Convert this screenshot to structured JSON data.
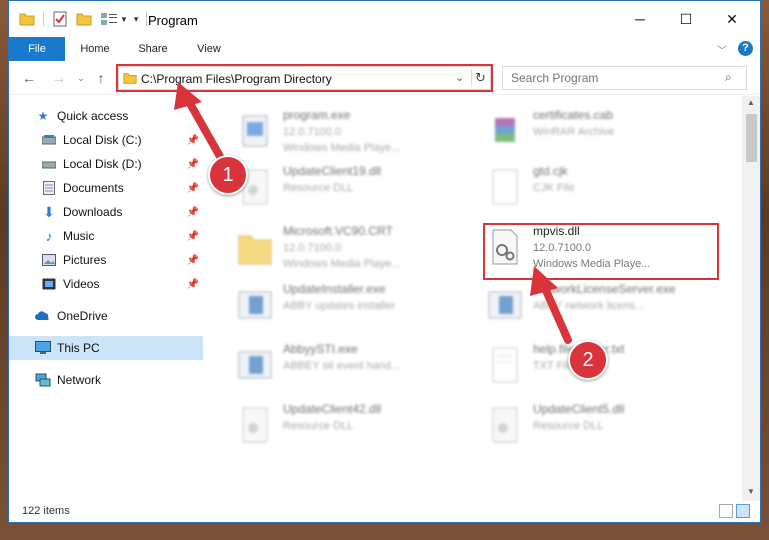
{
  "window": {
    "title": "Program",
    "minimize": "─",
    "maximize": "☐",
    "close": "✕"
  },
  "ribbon": {
    "tabs": [
      "File",
      "Home",
      "Share",
      "View"
    ]
  },
  "address": {
    "path": "C:\\Program Files\\Program Directory"
  },
  "search": {
    "placeholder": "Search Program"
  },
  "sidebar": {
    "items": [
      {
        "label": "Quick access",
        "icon": "star-icon"
      },
      {
        "label": "Local Disk (C:)",
        "icon": "drive-icon"
      },
      {
        "label": "Local Disk (D:)",
        "icon": "drive-icon"
      },
      {
        "label": "Documents",
        "icon": "documents-icon"
      },
      {
        "label": "Downloads",
        "icon": "download-icon"
      },
      {
        "label": "Music",
        "icon": "music-icon"
      },
      {
        "label": "Pictures",
        "icon": "pictures-icon"
      },
      {
        "label": "Videos",
        "icon": "videos-icon"
      },
      {
        "label": "OneDrive",
        "icon": "cloud-icon"
      },
      {
        "label": "This PC",
        "icon": "computer-icon"
      },
      {
        "label": "Network",
        "icon": "network-icon"
      }
    ]
  },
  "files": [
    {
      "name": "program.exe",
      "line1": "12.0.7100.0",
      "line2": "Windows Media Playe..."
    },
    {
      "name": "certificates.cab",
      "line1": "WinRAR Archive",
      "line2": ""
    },
    {
      "name": "UpdateClient19.dll",
      "line1": "Resource DLL",
      "line2": ""
    },
    {
      "name": "gtd.cjk",
      "line1": "CJK File",
      "line2": ""
    },
    {
      "name": "Microsoft.VC90.CRT",
      "line1": "12.0.7100.0",
      "line2": "Windows Media Playe..."
    },
    {
      "name": "mpvis.dll",
      "line1": "12.0.7100.0",
      "line2": "Windows Media Playe..."
    },
    {
      "name": "UpdateInstaller.exe",
      "line1": "ABBY updates installer",
      "line2": ""
    },
    {
      "name": "NetworkLicenseServer.exe",
      "line1": "ABBY network licens...",
      "line2": ""
    },
    {
      "name": "AbbyySTI.exe",
      "line1": "ABBEY sti event hand...",
      "line2": ""
    },
    {
      "name": "help.fileviewer.txt",
      "line1": "TXT File",
      "line2": ""
    },
    {
      "name": "UpdateClient42.dll",
      "line1": "Resource DLL",
      "line2": ""
    },
    {
      "name": "UpdateClient5.dll",
      "line1": "Resource DLL",
      "line2": ""
    }
  ],
  "status": {
    "count": "122 items"
  },
  "annotations": {
    "step1": "1",
    "step2": "2",
    "color": "#d9343b"
  }
}
